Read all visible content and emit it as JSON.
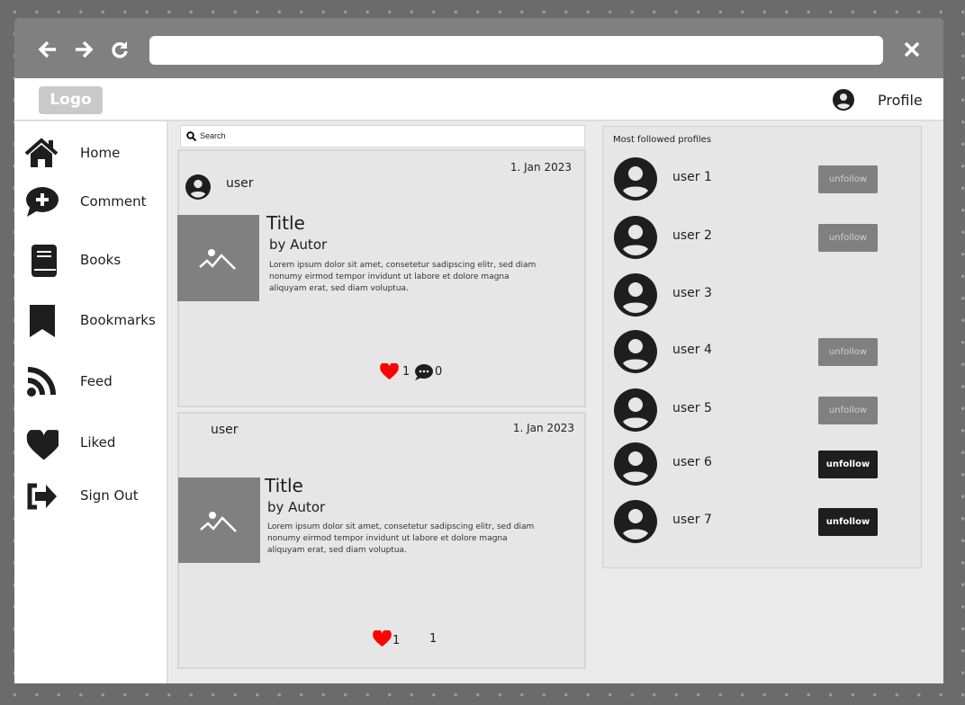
{
  "header": {
    "logo": "Logo",
    "profile": "Profile"
  },
  "search": {
    "placeholder": "Search"
  },
  "sidebar": {
    "items": [
      {
        "label": "Home",
        "icon": "home-icon"
      },
      {
        "label": "Comment",
        "icon": "comment-plus-icon"
      },
      {
        "label": "Books",
        "icon": "book-icon"
      },
      {
        "label": "Bookmarks",
        "icon": "bookmark-icon"
      },
      {
        "label": "Feed",
        "icon": "rss-feed-icon"
      },
      {
        "label": "Liked",
        "icon": "heart-icon"
      },
      {
        "label": "Sign Out",
        "icon": "sign-out-icon"
      }
    ]
  },
  "posts": [
    {
      "user": "user",
      "date": "1. Jan 2023",
      "title": "Title",
      "author": "by Autor",
      "text": "Lorem ipsum dolor sit amet, consetetur sadipscing elitr, sed diam nonumy eirmod tempor invidunt ut labore et dolore magna aliquyam erat, sed diam voluptua.",
      "likes": "1",
      "comments": "0"
    },
    {
      "user": "user",
      "date": "1. Jan 2023",
      "title": "Title",
      "author": "by Autor",
      "text": "Lorem ipsum dolor sit amet, consetetur sadipscing elitr, sed diam nonumy eirmod tempor invidunt ut labore et dolore magna aliquyam erat, sed diam voluptua.",
      "likes": "1",
      "comments": "1"
    }
  ],
  "profiles": {
    "title": "Most followed profiles",
    "items": [
      {
        "name": "user 1",
        "button": "unfollow",
        "style": "gray"
      },
      {
        "name": "user 2",
        "button": "unfollow",
        "style": "gray"
      },
      {
        "name": "user 3",
        "button": null
      },
      {
        "name": "user 4",
        "button": "unfollow",
        "style": "gray"
      },
      {
        "name": "user 5",
        "button": "unfollow",
        "style": "gray"
      },
      {
        "name": "user 6",
        "button": "unfollow",
        "style": "dark"
      },
      {
        "name": "user 7",
        "button": "unfollow",
        "style": "dark"
      }
    ]
  },
  "colors": {
    "like": "#ff0000",
    "accent_dark": "#1e1e1e",
    "muted": "#808080"
  }
}
